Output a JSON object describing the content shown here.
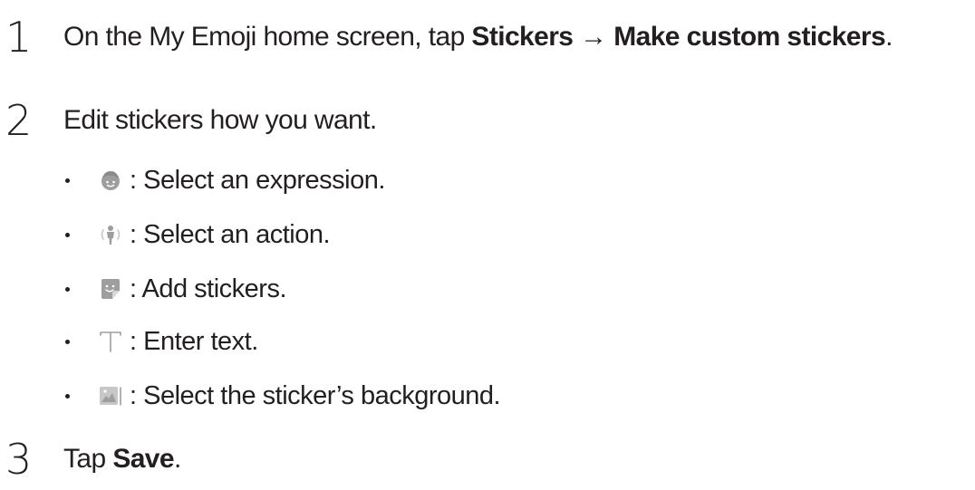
{
  "steps": [
    {
      "number": "1",
      "pre": "On the My Emoji home screen, tap ",
      "bold1": "Stickers",
      "arrow": " → ",
      "bold2": "Make custom stickers",
      "post": "."
    },
    {
      "number": "2",
      "text": "Edit stickers how you want."
    },
    {
      "number": "3",
      "pre": "Tap ",
      "bold1": "Save",
      "post": "."
    }
  ],
  "bullets": [
    {
      "icon": "expression-face-icon",
      "text": ": Select an expression."
    },
    {
      "icon": "action-figure-icon",
      "text": ": Select an action."
    },
    {
      "icon": "sticker-icon",
      "text": ": Add stickers."
    },
    {
      "icon": "text-t-icon",
      "text": ": Enter text."
    },
    {
      "icon": "background-image-icon",
      "text": ": Select the sticker’s background."
    }
  ],
  "colors": {
    "text": "#231f20",
    "icon_gray": "#9e9e9e",
    "icon_light": "#c7c7c7"
  }
}
